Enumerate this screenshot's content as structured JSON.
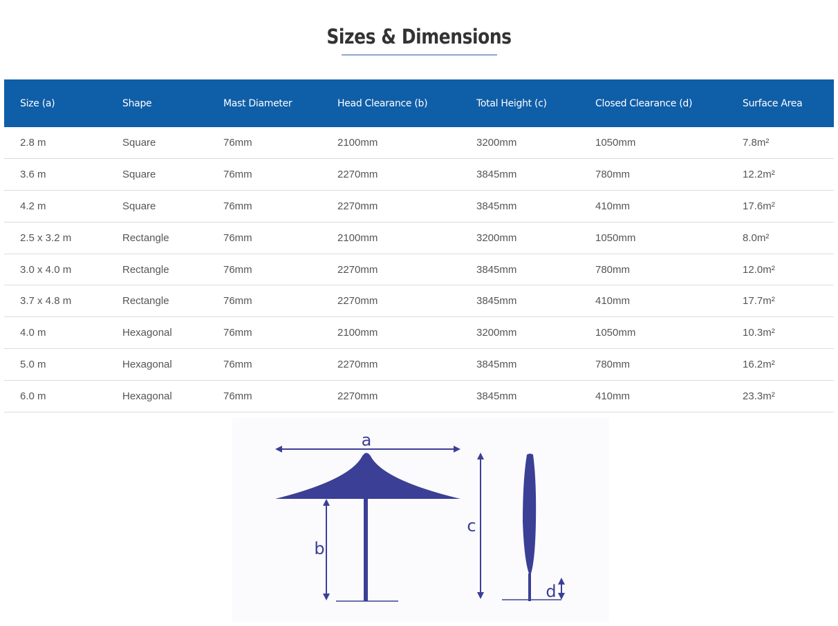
{
  "page": {
    "title": "Sizes & Dimensions"
  },
  "table": {
    "headers": [
      "Size (a)",
      "Shape",
      "Mast Diameter",
      "Head Clearance (b)",
      "Total Height (c)",
      "Closed Clearance (d)",
      "Surface Area"
    ],
    "rows": [
      [
        "2.8 m",
        "Square",
        "76mm",
        "2100mm",
        "3200mm",
        "1050mm",
        "7.8m²"
      ],
      [
        "3.6 m",
        "Square",
        "76mm",
        "2270mm",
        "3845mm",
        "780mm",
        "12.2m²"
      ],
      [
        "4.2 m",
        "Square",
        "76mm",
        "2270mm",
        "3845mm",
        "410mm",
        "17.6m²"
      ],
      [
        "2.5 x 3.2 m",
        "Rectangle",
        "76mm",
        "2100mm",
        "3200mm",
        "1050mm",
        "8.0m²"
      ],
      [
        "3.0 x 4.0 m",
        "Rectangle",
        "76mm",
        "2270mm",
        "3845mm",
        "780mm",
        "12.0m²"
      ],
      [
        "3.7 x 4.8 m",
        "Rectangle",
        "76mm",
        "2270mm",
        "3845mm",
        "410mm",
        "17.7m²"
      ],
      [
        "4.0 m",
        "Hexagonal",
        "76mm",
        "2100mm",
        "3200mm",
        "1050mm",
        "10.3m²"
      ],
      [
        "5.0 m",
        "Hexagonal",
        "76mm",
        "2270mm",
        "3845mm",
        "780mm",
        "16.2m²"
      ],
      [
        "6.0 m",
        "Hexagonal",
        "76mm",
        "2270mm",
        "3845mm",
        "410mm",
        "23.3m²"
      ]
    ]
  },
  "diagram": {
    "label_a": "a",
    "label_b": "b",
    "label_c": "c",
    "label_d": "d"
  },
  "colors": {
    "header_bg": "#0f5ea8",
    "diagram_blue": "#3b3f95"
  }
}
